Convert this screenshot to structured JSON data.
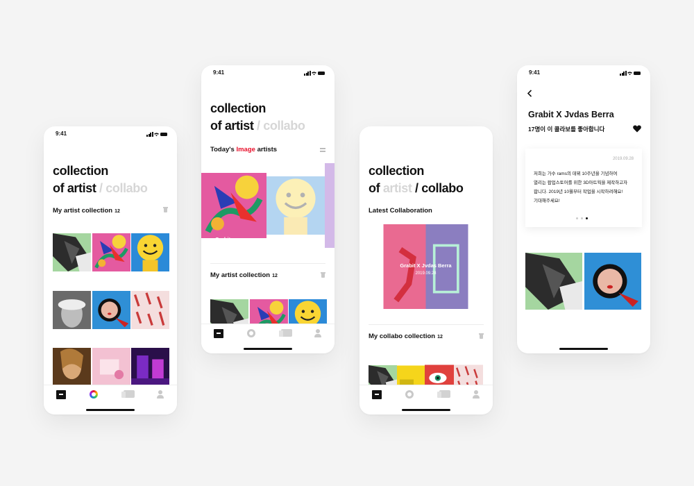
{
  "status_time": "9:41",
  "title": {
    "line1": "collection",
    "of": "of",
    "artist": "artist",
    "slash": "/",
    "collabo": "collabo"
  },
  "screen1": {
    "section_label": "My artist collection",
    "section_count": "12"
  },
  "screen2": {
    "today_prefix": "Today's",
    "today_highlight": "Image",
    "today_suffix": "artists",
    "carousel_caption": "Grabit",
    "section_label": "My artist collection",
    "section_count": "12"
  },
  "screen3": {
    "latest_label": "Latest Collaboration",
    "card_title": "Grabit X Jvdas Berra",
    "card_date": "2019.09.28",
    "section_label": "My collabo collection",
    "section_count": "12"
  },
  "screen4": {
    "heading": "Grabit X Jvdas Berra",
    "likes_text": "17명이 이 콜라보를 좋아합니다",
    "card_date": "2019.09.28",
    "card_line1": "저희는 가수 rams의 데뷔 10주년을 기념하여",
    "card_line2": "열리는 팝업스토어를 위한 3D아트웍을 제작하고자",
    "card_line3": "합니다. 2019년 10월부터 작업을 시작하려해요!",
    "card_line4": "기대해주세요!",
    "artist1": "Grabit",
    "artist2": "Jvdas Berra"
  },
  "colors": {
    "accent_red": "#e8102b",
    "dim_text": "#d6d6d6",
    "background": "#f4f4f4"
  },
  "nav_icons": [
    "archive-icon",
    "ring-icon",
    "photos-icon",
    "profile-icon"
  ]
}
